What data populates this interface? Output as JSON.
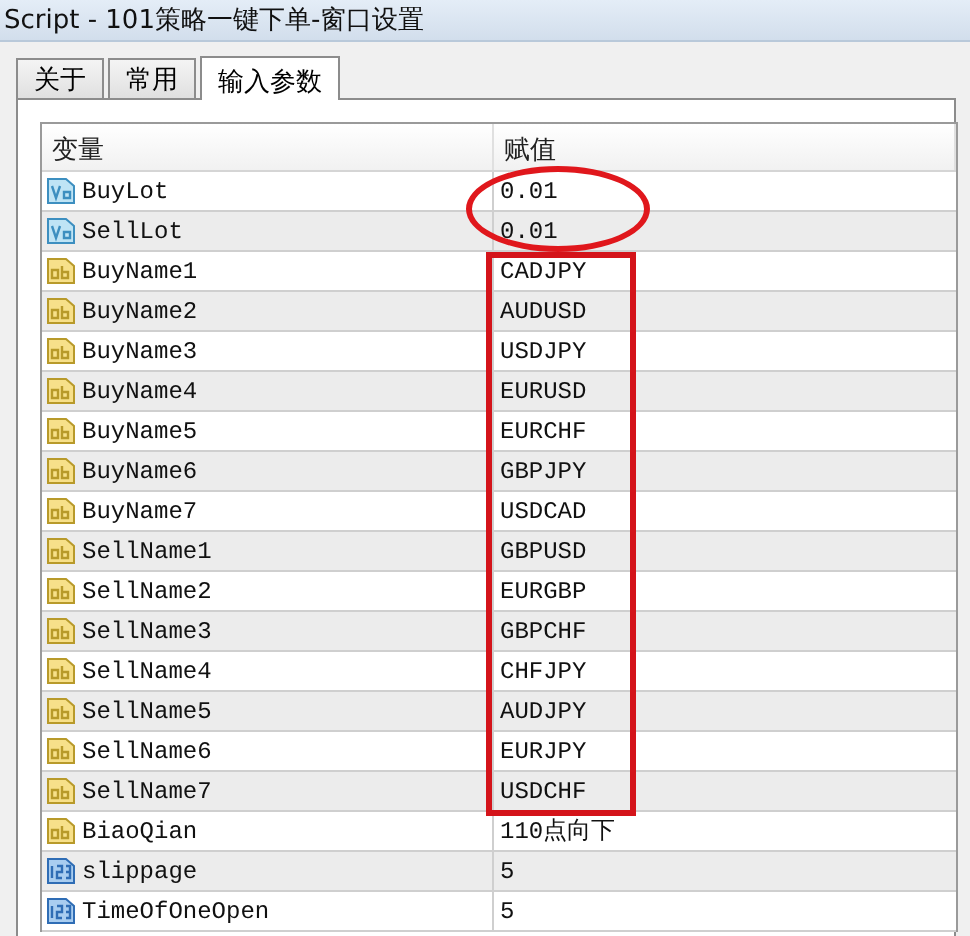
{
  "window": {
    "title": "Script - 101策略一键下单-窗口设置"
  },
  "tabs": [
    {
      "label": "关于",
      "selected": false
    },
    {
      "label": "常用",
      "selected": false
    },
    {
      "label": "输入参数",
      "selected": true
    }
  ],
  "table": {
    "columns": [
      "变量",
      "赋值"
    ],
    "rows": [
      {
        "kind": "double",
        "name": "BuyLot",
        "value": "0.01"
      },
      {
        "kind": "double",
        "name": "SellLot",
        "value": "0.01"
      },
      {
        "kind": "string",
        "name": "BuyName1",
        "value": "CADJPY"
      },
      {
        "kind": "string",
        "name": "BuyName2",
        "value": "AUDUSD"
      },
      {
        "kind": "string",
        "name": "BuyName3",
        "value": "USDJPY"
      },
      {
        "kind": "string",
        "name": "BuyName4",
        "value": "EURUSD"
      },
      {
        "kind": "string",
        "name": "BuyName5",
        "value": "EURCHF"
      },
      {
        "kind": "string",
        "name": "BuyName6",
        "value": "GBPJPY"
      },
      {
        "kind": "string",
        "name": "BuyName7",
        "value": "USDCAD"
      },
      {
        "kind": "string",
        "name": "SellName1",
        "value": "GBPUSD"
      },
      {
        "kind": "string",
        "name": "SellName2",
        "value": "EURGBP"
      },
      {
        "kind": "string",
        "name": "SellName3",
        "value": "GBPCHF"
      },
      {
        "kind": "string",
        "name": "SellName4",
        "value": "CHFJPY"
      },
      {
        "kind": "string",
        "name": "SellName5",
        "value": "AUDJPY"
      },
      {
        "kind": "string",
        "name": "SellName6",
        "value": "EURJPY"
      },
      {
        "kind": "string",
        "name": "SellName7",
        "value": "USDCHF"
      },
      {
        "kind": "string",
        "name": "BiaoQian",
        "value": "110点向下"
      },
      {
        "kind": "int",
        "name": "slippage",
        "value": "5"
      },
      {
        "kind": "int",
        "name": "TimeOfOneOpen",
        "value": "5"
      }
    ]
  },
  "annotations": [
    {
      "kind": "ellipse"
    },
    {
      "kind": "rectangle"
    }
  ]
}
